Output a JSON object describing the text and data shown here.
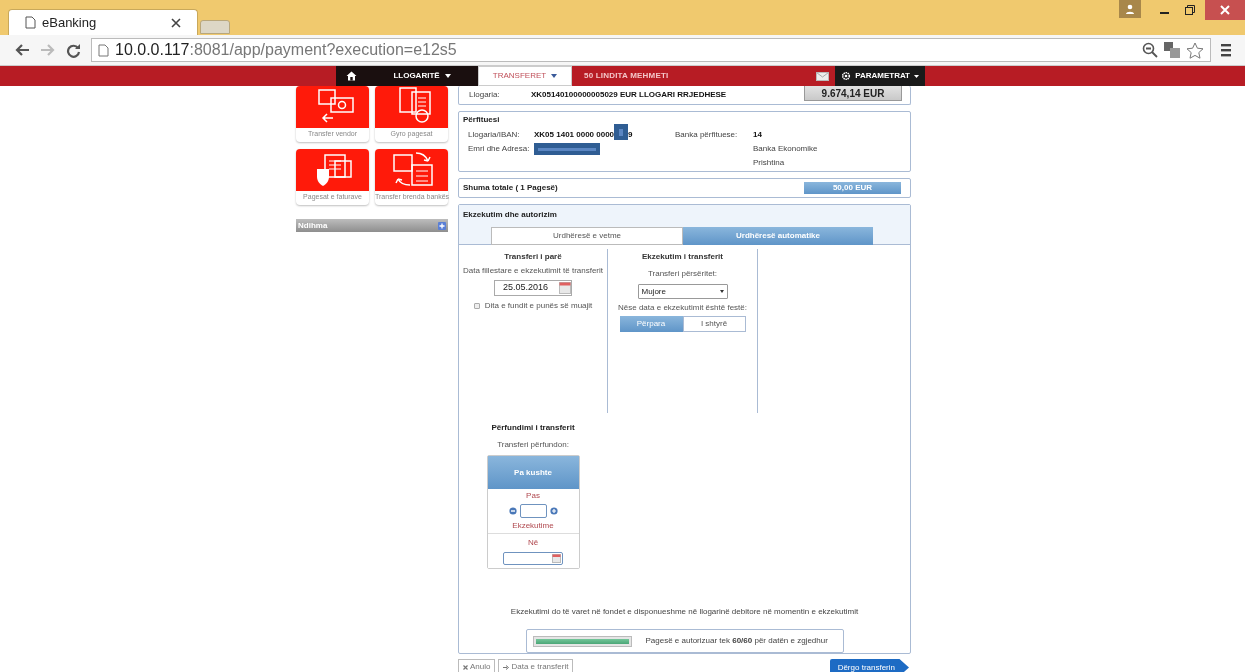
{
  "browser": {
    "tab_title": "eBanking",
    "url_host": "10.0.0.117",
    "url_rest": ":8081/app/payment?execution=e12s5"
  },
  "nav": {
    "items": [
      {
        "kind": "home",
        "selected": false
      },
      {
        "kind": "menu",
        "label": "LLOGARITË",
        "selected": false
      },
      {
        "kind": "menu",
        "label": "TRANSFERET",
        "selected": true
      }
    ],
    "behind_text": "50 LINDITA MEHMETI",
    "settings": "PARAMETRAT"
  },
  "sidebar": {
    "tiles": [
      {
        "kind": "cash",
        "label": "Transfer vendor"
      },
      {
        "kind": "giro",
        "label": "Gyro pagesat"
      },
      {
        "kind": "bills",
        "label": "Pagesat e faturave"
      },
      {
        "kind": "bank",
        "label": "Transfer brenda bankës"
      }
    ],
    "help": "Ndihma"
  },
  "sender": {
    "label": "Llogaria:",
    "account": "XK05140100000005029 EUR LLOGARI RRJEDHESE",
    "balance": "9.674,14 EUR"
  },
  "beneficiary": {
    "title": "Përfituesi",
    "iban_label": "Llogaria/IBAN:",
    "iban_start": "XK05 1401 0000 0000",
    "iban_end": "9",
    "name_label": "Emri dhe Adresa:",
    "bank_label": "Banka përfituese:",
    "bank_code": "14",
    "bank_name": "Banka Ekonomike",
    "bank_city": "Prishtina"
  },
  "total": {
    "label": "Shuma totale ( 1 Pagesë)",
    "amount": "50,00 EUR"
  },
  "execution": {
    "title": "Ekzekutim dhe autorizim",
    "modes": [
      {
        "label": "Urdhëresë e vetme",
        "selected": false
      },
      {
        "label": "Urdhëresë automatike",
        "selected": true
      }
    ],
    "first": {
      "title": "Transferi i parë",
      "label": "Data fillestare e ekzekutimit të transferit",
      "date": "25.05.2016",
      "checkbox": {
        "label": "Dita e fundit e punës së muajit",
        "checked": false
      }
    },
    "repeat": {
      "title": "Ekzekutim i transferit",
      "label": "Transferi përsëritet:",
      "value": "Mujore",
      "holiday_label": "Nëse data e ekzekutimit është festë:",
      "options": [
        {
          "label": "Përpara",
          "selected": true
        },
        {
          "label": "I shtyrë",
          "selected": false
        }
      ]
    },
    "end": {
      "title": "Përfundimi i transferit",
      "label": "Transferi përfundon:",
      "options": [
        {
          "kind": "none",
          "label": "Pa kushte",
          "selected": true
        },
        {
          "kind": "count",
          "label": "Pas",
          "unit": "Ekzekutime",
          "selected": false
        },
        {
          "kind": "date",
          "label": "Në",
          "selected": false
        }
      ]
    },
    "note": "Ekzekutimi do të varet në fondet e disponueshme në llogarinë debitore në momentin e ekzekutimit",
    "progress": {
      "level": 1,
      "text": "Pagesë e autorizuar tek **60/60** për datën e zgjedhur"
    }
  },
  "buttons": [
    {
      "kind": "cancel",
      "label": "Anulo"
    },
    {
      "kind": "back",
      "label": "Data e transferit"
    },
    {
      "kind": "submit",
      "label": "Dërgo transferin"
    }
  ]
}
